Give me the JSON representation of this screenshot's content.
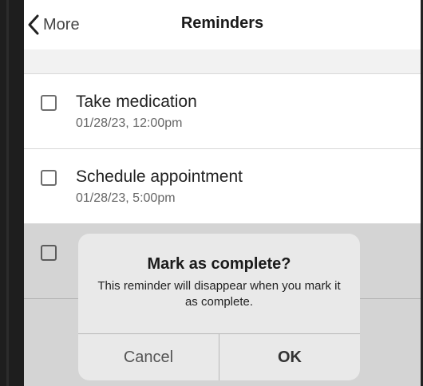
{
  "nav": {
    "back_label": "More",
    "title": "Reminders"
  },
  "reminders": [
    {
      "title": "Take medication",
      "datetime": "01/28/23, 12:00pm",
      "checked": false
    },
    {
      "title": "Schedule appointment",
      "datetime": "01/28/23, 5:00pm",
      "checked": false
    },
    {
      "title": "",
      "datetime": "",
      "checked": false
    }
  ],
  "dialog": {
    "title": "Mark as complete?",
    "message": "This reminder will disappear when you mark it as complete.",
    "cancel_label": "Cancel",
    "ok_label": "OK"
  },
  "icons": {
    "back": "chevron-left-icon",
    "checkbox": "checkbox-empty"
  },
  "colors": {
    "text": "#222222",
    "subtext": "#666666",
    "dialog_bg": "#e9e9e9"
  }
}
